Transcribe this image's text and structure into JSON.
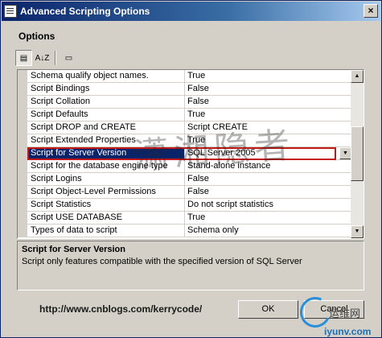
{
  "window": {
    "title": "Advanced Scripting Options",
    "close": "×"
  },
  "section": {
    "title": "Options"
  },
  "toolbar": {
    "categorized": "▤",
    "alphabetical": "A↓Z",
    "pages": "▭"
  },
  "properties": [
    {
      "name": "Schema qualify object names.",
      "value": "True"
    },
    {
      "name": "Script Bindings",
      "value": "False"
    },
    {
      "name": "Script Collation",
      "value": "False"
    },
    {
      "name": "Script Defaults",
      "value": "True"
    },
    {
      "name": "Script DROP and CREATE",
      "value": "Script CREATE"
    },
    {
      "name": "Script Extended Properties",
      "value": "True"
    },
    {
      "name": "Script for Server Version",
      "value": "SQL Server 2005",
      "selected": true
    },
    {
      "name": "Script for the database engine type",
      "value": "Stand-alone instance"
    },
    {
      "name": "Script Logins",
      "value": "False"
    },
    {
      "name": "Script Object-Level Permissions",
      "value": "False"
    },
    {
      "name": "Script Statistics",
      "value": "Do not script statistics"
    },
    {
      "name": "Script USE DATABASE",
      "value": "True"
    },
    {
      "name": "Types of data to script",
      "value": "Schema only"
    }
  ],
  "description": {
    "title": "Script for Server Version",
    "text": "Script only features compatible with the specified version of SQL Server"
  },
  "footer": {
    "url": "http://www.cnblogs.com/kerrycode/"
  },
  "buttons": {
    "ok": "OK",
    "cancel": "Cancel"
  },
  "watermark": {
    "text": "潇湘隐者",
    "logo_text": "iyunv.com",
    "logo_cn": "运维网"
  },
  "colors": {
    "selection": "#0a246a",
    "highlight_border": "#c41818",
    "titlebar": "#0a246a"
  },
  "icons": {
    "dropdown": "▼",
    "scroll_up": "▲",
    "scroll_down": "▼"
  }
}
